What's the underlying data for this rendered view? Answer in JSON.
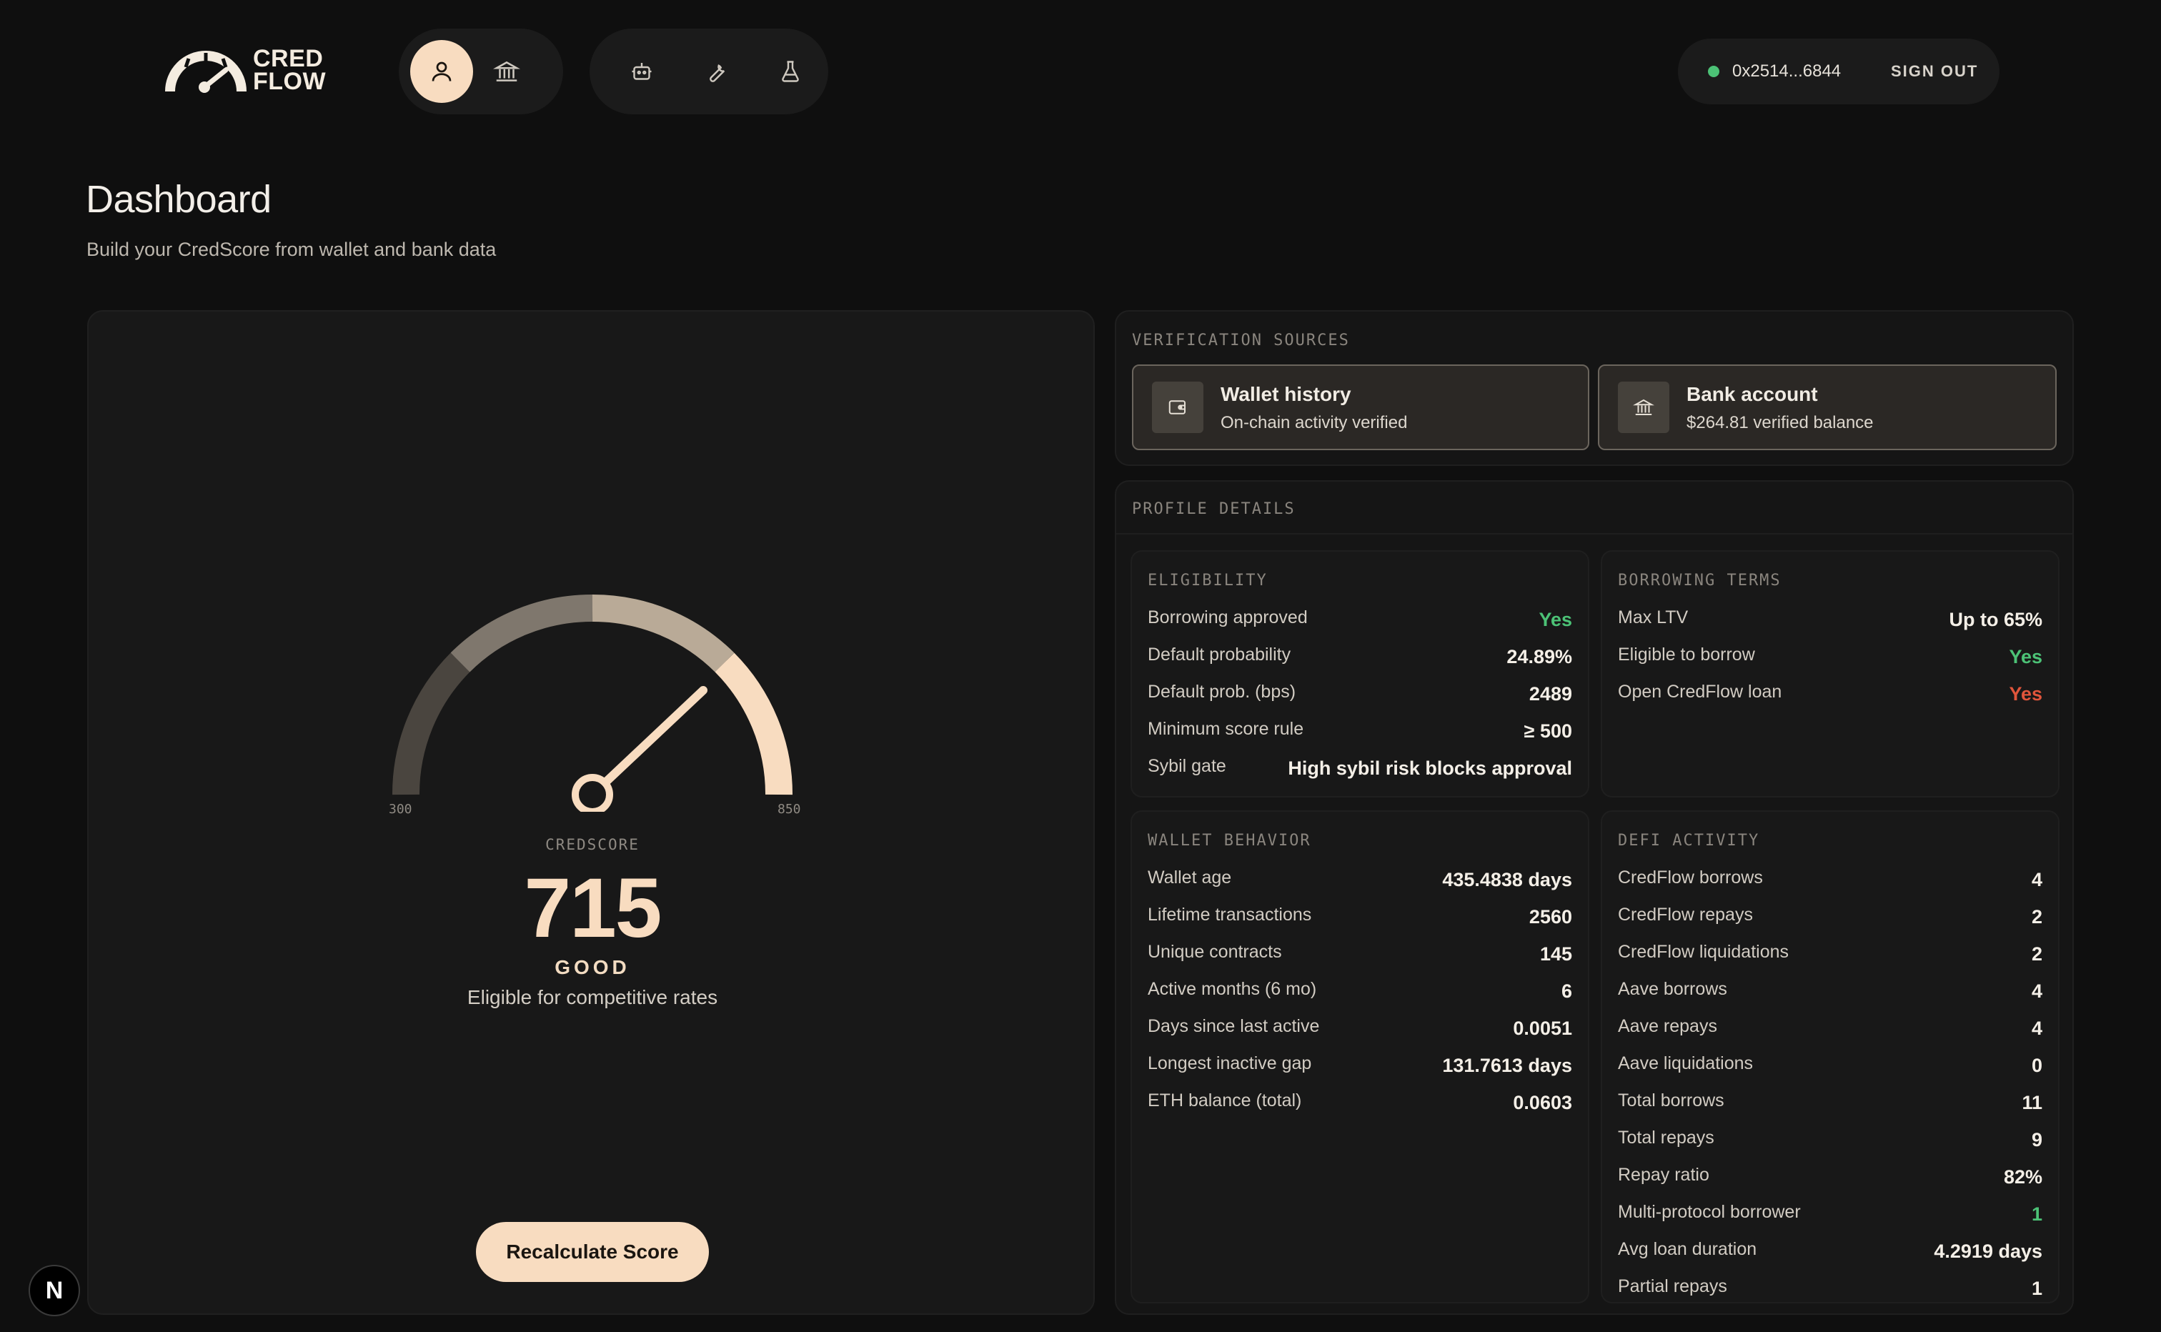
{
  "brand": {
    "logo_text_line1": "CRED",
    "logo_text_line2": "FLOW"
  },
  "nav": {
    "items": [
      {
        "icon": "user-icon",
        "active": true
      },
      {
        "icon": "bank-icon",
        "active": false
      },
      {
        "icon": "robot-icon",
        "active": false
      },
      {
        "icon": "wrench-icon",
        "active": false
      },
      {
        "icon": "flask-icon",
        "active": false
      }
    ]
  },
  "account": {
    "address": "0x2514...6844",
    "status_color": "#4cc276",
    "sign_out_label": "SIGN OUT"
  },
  "page": {
    "title": "Dashboard",
    "subtitle": "Build your CredScore from wallet and bank data"
  },
  "score": {
    "min_label": "300",
    "max_label": "850",
    "label": "CREDSCORE",
    "value": "715",
    "grade": "GOOD",
    "description": "Eligible for competitive rates",
    "recalc_label": "Recalculate Score",
    "accent_color": "#f8dcc0"
  },
  "verification": {
    "heading": "VERIFICATION SOURCES",
    "sources": [
      {
        "icon": "wallet-icon",
        "title": "Wallet history",
        "subtitle": "On-chain activity verified"
      },
      {
        "icon": "bank-icon",
        "title": "Bank account",
        "subtitle": "$264.81 verified balance"
      }
    ]
  },
  "profile": {
    "heading": "PROFILE DETAILS",
    "eligibility": {
      "title": "ELIGIBILITY",
      "rows": [
        {
          "k": "Borrowing approved",
          "v": "Yes"
        },
        {
          "k": "Default probability",
          "v": "24.89%"
        },
        {
          "k": "Default prob. (bps)",
          "v": "2489"
        },
        {
          "k": "Minimum score rule",
          "v": "≥ 500"
        },
        {
          "k": "Sybil gate",
          "v": "High sybil risk blocks approval"
        }
      ]
    },
    "terms": {
      "title": "BORROWING TERMS",
      "rows": [
        {
          "k": "Max LTV",
          "v": "Up to 65%"
        },
        {
          "k": "Eligible to borrow",
          "v": "Yes"
        },
        {
          "k": "Open CredFlow loan",
          "v": "Yes"
        }
      ]
    },
    "wallet": {
      "title": "WALLET BEHAVIOR",
      "rows": [
        {
          "k": "Wallet age",
          "v": "435.4838 days"
        },
        {
          "k": "Lifetime transactions",
          "v": "2560"
        },
        {
          "k": "Unique contracts",
          "v": "145"
        },
        {
          "k": "Active months (6 mo)",
          "v": "6"
        },
        {
          "k": "Days since last active",
          "v": "0.0051"
        },
        {
          "k": "Longest inactive gap",
          "v": "131.7613 days"
        },
        {
          "k": "ETH balance (total)",
          "v": "0.0603"
        }
      ]
    },
    "defi": {
      "title": "DEFI ACTIVITY",
      "rows": [
        {
          "k": "CredFlow borrows",
          "v": "4"
        },
        {
          "k": "CredFlow repays",
          "v": "2"
        },
        {
          "k": "CredFlow liquidations",
          "v": "2"
        },
        {
          "k": "Aave borrows",
          "v": "4"
        },
        {
          "k": "Aave repays",
          "v": "4"
        },
        {
          "k": "Aave liquidations",
          "v": "0"
        },
        {
          "k": "Total borrows",
          "v": "11"
        },
        {
          "k": "Total repays",
          "v": "9"
        },
        {
          "k": "Repay ratio",
          "v": "82%"
        },
        {
          "k": "Multi-protocol borrower",
          "v": "1"
        },
        {
          "k": "Avg loan duration",
          "v": "4.2919 days"
        },
        {
          "k": "Partial repays",
          "v": "1"
        }
      ]
    }
  },
  "colors": {
    "positive": "#4cc276",
    "negative": "#e0553b"
  },
  "next_badge": "N"
}
